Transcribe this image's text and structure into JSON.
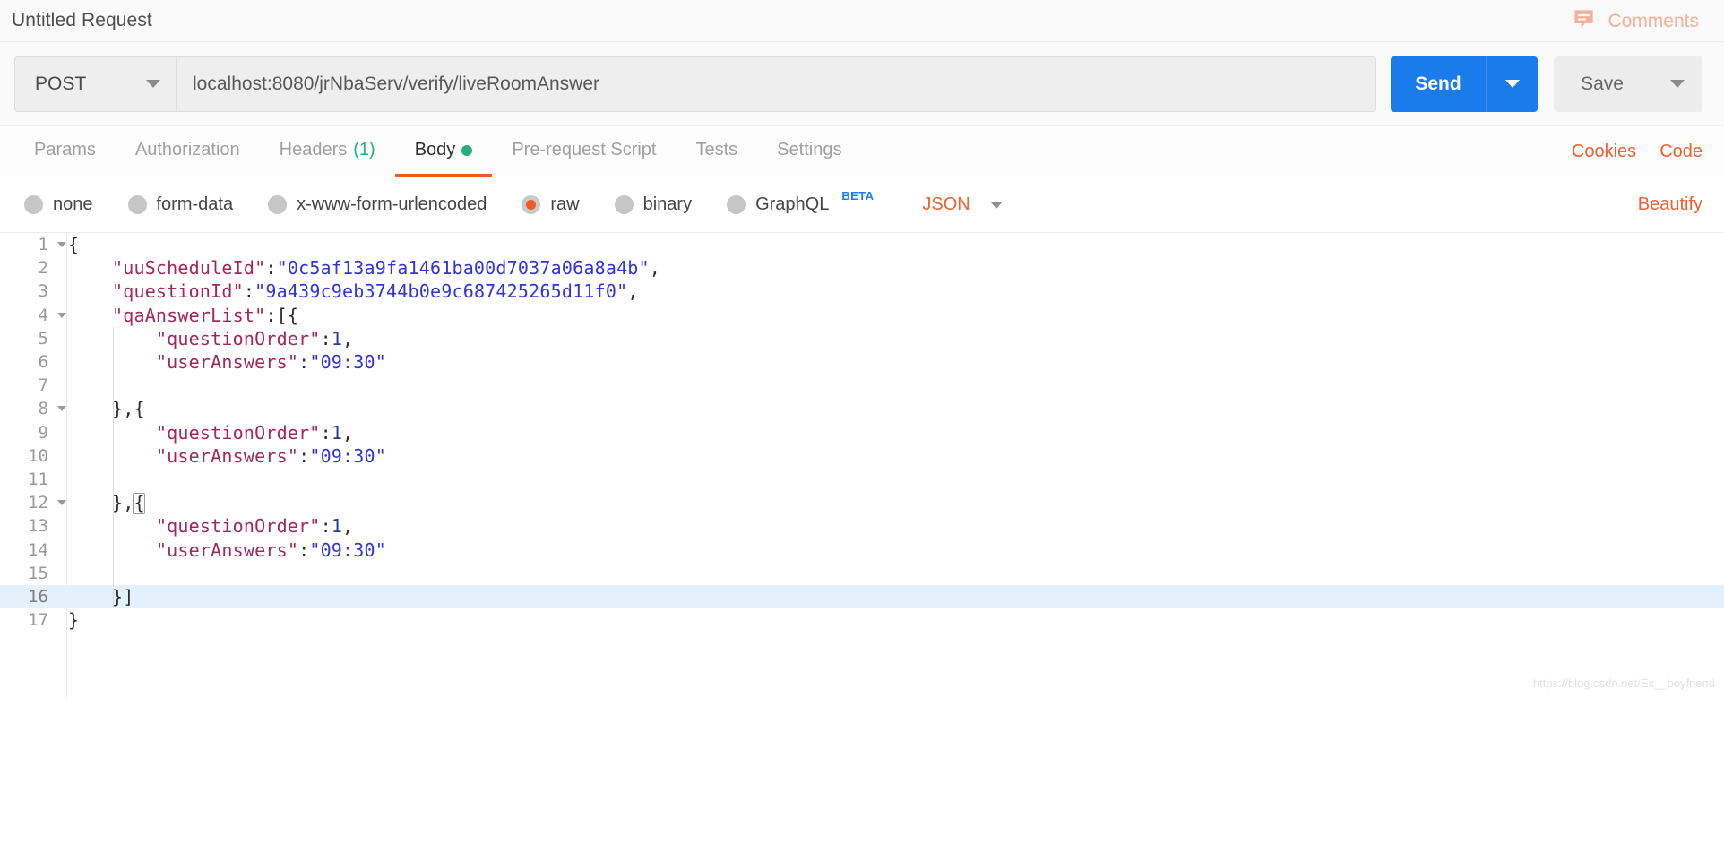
{
  "titlebar": {
    "request_title": "Untitled Request",
    "comments_label": "Comments",
    "comments_icon": "comment-icon",
    "comments_color": "#f5b09a"
  },
  "request": {
    "method": "POST",
    "method_caret_icon": "chevron-down-icon",
    "url": "localhost:8080/jrNbaServ/verify/liveRoomAnswer",
    "url_placeholder": "Enter request URL",
    "send_label": "Send",
    "send_caret_icon": "chevron-down-icon",
    "send_color": "#1a7ceb",
    "save_label": "Save",
    "save_caret_icon": "chevron-down-icon"
  },
  "tabs": {
    "items": [
      {
        "label": "Params",
        "count": "",
        "active": false,
        "dot": false
      },
      {
        "label": "Authorization",
        "count": "",
        "active": false,
        "dot": false
      },
      {
        "label": "Headers",
        "count": "(1)",
        "active": false,
        "dot": false
      },
      {
        "label": "Body",
        "count": "",
        "active": true,
        "dot": true
      },
      {
        "label": "Pre-request Script",
        "count": "",
        "active": false,
        "dot": false
      },
      {
        "label": "Tests",
        "count": "",
        "active": false,
        "dot": false
      },
      {
        "label": "Settings",
        "count": "",
        "active": false,
        "dot": false
      }
    ],
    "cookies_label": "Cookies",
    "code_label": "Code",
    "accent_color": "#ef5b25",
    "count_color": "#22b07d"
  },
  "body_options": {
    "radios": [
      {
        "label": "none",
        "checked": false
      },
      {
        "label": "form-data",
        "checked": false
      },
      {
        "label": "x-www-form-urlencoded",
        "checked": false
      },
      {
        "label": "raw",
        "checked": true
      },
      {
        "label": "binary",
        "checked": false
      },
      {
        "label": "GraphQL",
        "checked": false,
        "badge": "BETA"
      }
    ],
    "format": "JSON",
    "format_caret_icon": "chevron-down-icon",
    "beautify_label": "Beautify",
    "selected_color": "#ef5b25"
  },
  "editor": {
    "highlight_line": 16,
    "fold_lines": [
      1,
      4,
      8,
      12
    ],
    "watermark": "https://blog.csdn.net/Ex__boyfriend",
    "lines": [
      {
        "n": 1,
        "tokens": [
          {
            "t": "punc",
            "v": "{"
          }
        ]
      },
      {
        "n": 2,
        "tokens": [
          {
            "t": "punc",
            "v": "    "
          },
          {
            "t": "key",
            "v": "\"uuScheduleId\""
          },
          {
            "t": "punc",
            "v": ":"
          },
          {
            "t": "str",
            "v": "\"0c5af13a9fa1461ba00d7037a06a8a4b\""
          },
          {
            "t": "punc",
            "v": ","
          }
        ]
      },
      {
        "n": 3,
        "tokens": [
          {
            "t": "punc",
            "v": "    "
          },
          {
            "t": "key",
            "v": "\"questionId\""
          },
          {
            "t": "punc",
            "v": ":"
          },
          {
            "t": "str",
            "v": "\"9a439c9eb3744b0e9c687425265d11f0\""
          },
          {
            "t": "punc",
            "v": ","
          }
        ]
      },
      {
        "n": 4,
        "tokens": [
          {
            "t": "punc",
            "v": "    "
          },
          {
            "t": "key",
            "v": "\"qaAnswerList\""
          },
          {
            "t": "punc",
            "v": ":[{"
          }
        ]
      },
      {
        "n": 5,
        "tokens": [
          {
            "t": "punc",
            "v": "        "
          },
          {
            "t": "key",
            "v": "\"questionOrder\""
          },
          {
            "t": "punc",
            "v": ":"
          },
          {
            "t": "num",
            "v": "1"
          },
          {
            "t": "punc",
            "v": ","
          }
        ]
      },
      {
        "n": 6,
        "tokens": [
          {
            "t": "punc",
            "v": "        "
          },
          {
            "t": "key",
            "v": "\"userAnswers\""
          },
          {
            "t": "punc",
            "v": ":"
          },
          {
            "t": "str",
            "v": "\"09:30\""
          }
        ]
      },
      {
        "n": 7,
        "tokens": []
      },
      {
        "n": 8,
        "tokens": [
          {
            "t": "punc",
            "v": "    },{"
          }
        ]
      },
      {
        "n": 9,
        "tokens": [
          {
            "t": "punc",
            "v": "        "
          },
          {
            "t": "key",
            "v": "\"questionOrder\""
          },
          {
            "t": "punc",
            "v": ":"
          },
          {
            "t": "num",
            "v": "1"
          },
          {
            "t": "punc",
            "v": ","
          }
        ]
      },
      {
        "n": 10,
        "tokens": [
          {
            "t": "punc",
            "v": "        "
          },
          {
            "t": "key",
            "v": "\"userAnswers\""
          },
          {
            "t": "punc",
            "v": ":"
          },
          {
            "t": "str",
            "v": "\"09:30\""
          }
        ]
      },
      {
        "n": 11,
        "tokens": []
      },
      {
        "n": 12,
        "tokens": [
          {
            "t": "punc",
            "v": "    },{"
          }
        ]
      },
      {
        "n": 13,
        "tokens": [
          {
            "t": "punc",
            "v": "        "
          },
          {
            "t": "key",
            "v": "\"questionOrder\""
          },
          {
            "t": "punc",
            "v": ":"
          },
          {
            "t": "num",
            "v": "1"
          },
          {
            "t": "punc",
            "v": ","
          }
        ]
      },
      {
        "n": 14,
        "tokens": [
          {
            "t": "punc",
            "v": "        "
          },
          {
            "t": "key",
            "v": "\"userAnswers\""
          },
          {
            "t": "punc",
            "v": ":"
          },
          {
            "t": "str",
            "v": "\"09:30\""
          }
        ]
      },
      {
        "n": 15,
        "tokens": []
      },
      {
        "n": 16,
        "tokens": [
          {
            "t": "punc",
            "v": "    }]"
          }
        ]
      },
      {
        "n": 17,
        "tokens": [
          {
            "t": "punc",
            "v": "}"
          }
        ]
      }
    ]
  }
}
